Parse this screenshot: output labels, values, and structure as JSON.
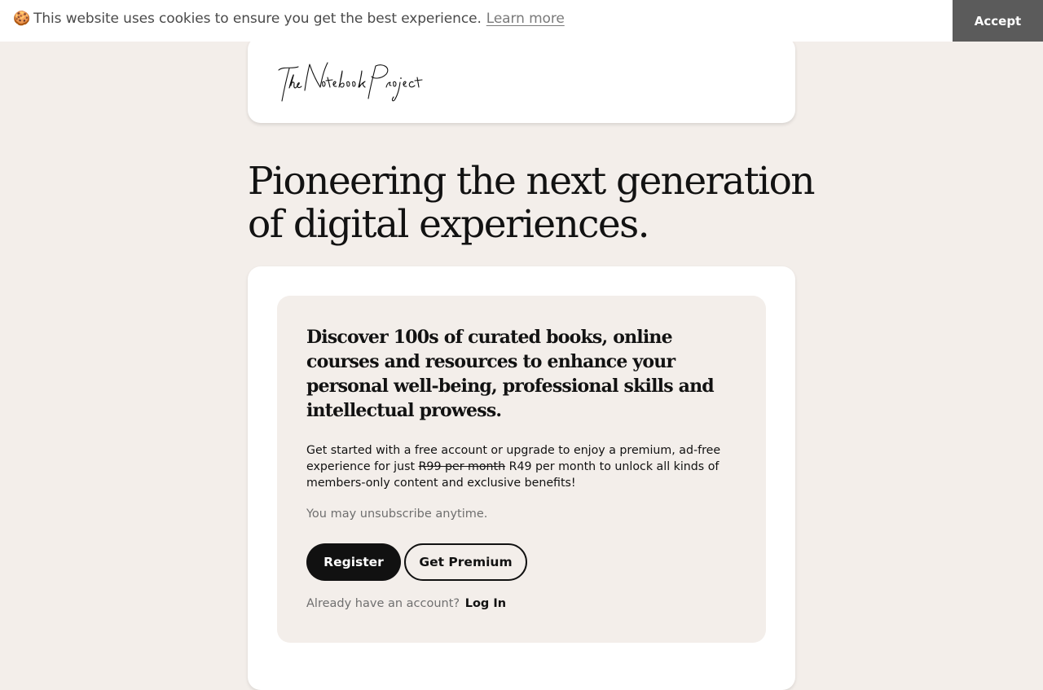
{
  "cookie_banner": {
    "emoji": "🍪",
    "message": "This website uses cookies to ensure you get the best experience.",
    "learn_more": "Learn more",
    "accept_label": "Accept"
  },
  "header": {
    "logo_text": "The Notebook Project"
  },
  "hero": {
    "title": "Pioneering the next generation of digital experiences."
  },
  "signup_card": {
    "heading": "Discover 100s of curated books, online courses and resources to enhance your personal well-being, professional skills and intellectual prowess.",
    "body_prefix": "Get started with a free account or upgrade to enjoy a premium, ad-free experience for just ",
    "old_price": "R99 per month",
    "body_suffix": " R49 per month to unlock all kinds of members-only content and exclusive benefits!",
    "unsubscribe_note": "You may unsubscribe anytime.",
    "register_label": "Register",
    "premium_label": "Get Premium",
    "login_prompt": "Already have an account?",
    "login_label": "Log In"
  },
  "colors": {
    "page_background": "#f3eeea",
    "card_background": "#ffffff",
    "accept_button": "#5b5b5b",
    "primary_button": "#111111",
    "muted_text": "#6f6f6f"
  }
}
